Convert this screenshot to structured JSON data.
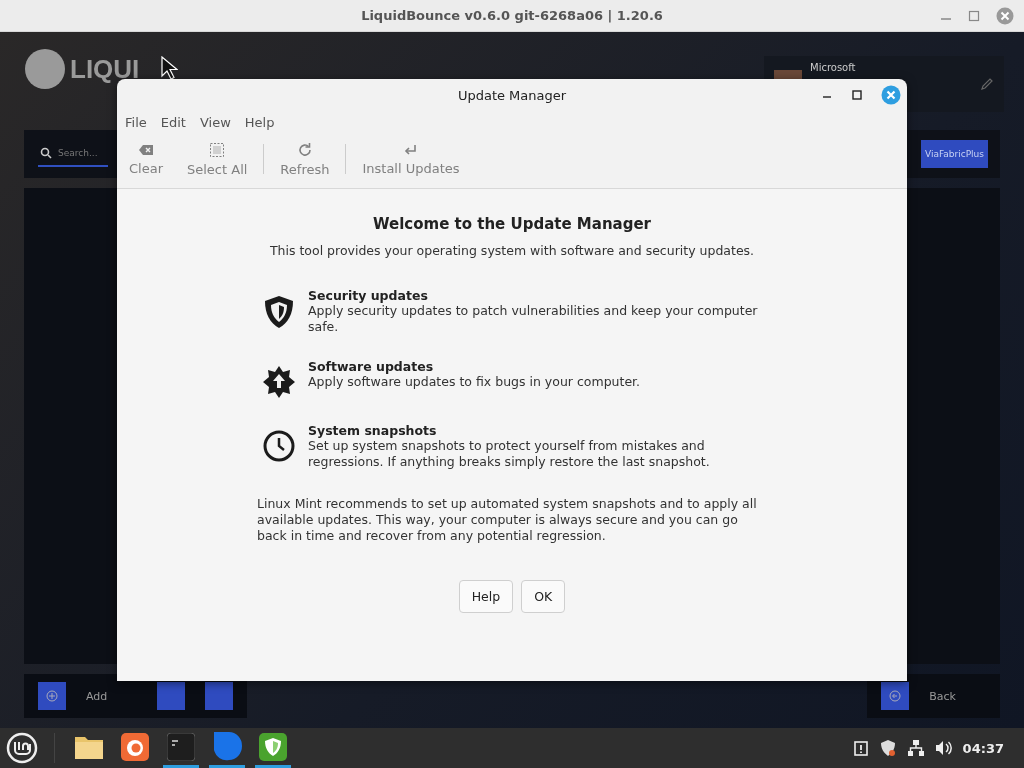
{
  "outer_window": {
    "title": "LiquidBounce v0.6.0 git-6268a06 | 1.20.6"
  },
  "background_app": {
    "logo": "LIQUI",
    "search": {
      "placeholder": "Search..."
    },
    "account": {
      "name": "Microsoft"
    },
    "protocol_button": "ViaFabricPlus",
    "bottom_buttons": [
      {
        "label": "Add"
      },
      {
        "label": "Back"
      }
    ]
  },
  "dialog": {
    "title": "Update Manager",
    "menu": [
      "File",
      "Edit",
      "View",
      "Help"
    ],
    "toolbar": [
      {
        "label": "Clear",
        "disabled": true
      },
      {
        "label": "Select All",
        "disabled": true
      },
      {
        "label": "Refresh",
        "disabled": true
      },
      {
        "label": "Install Updates",
        "disabled": true
      }
    ],
    "heading": "Welcome to the Update Manager",
    "intro": "This tool provides your operating system with software and security updates.",
    "features": [
      {
        "title": "Security updates",
        "text": "Apply security updates to patch vulnerabilities and keep your computer safe."
      },
      {
        "title": "Software updates",
        "text": "Apply software updates to fix bugs in your computer."
      },
      {
        "title": "System snapshots",
        "text": "Set up system snapshots to protect yourself from mistakes and regressions. If anything breaks simply restore the last snapshot."
      }
    ],
    "note": "Linux Mint recommends to set up automated system snapshots and to apply all available updates. This way, your computer is always secure and you can go back in time and recover from any potential regression.",
    "buttons": [
      "Help",
      "OK"
    ]
  },
  "taskbar": {
    "apps": [
      {
        "running": false
      },
      {
        "running": false
      },
      {
        "running": true
      },
      {
        "running": true
      },
      {
        "running": true
      }
    ],
    "clock": "04:37"
  }
}
